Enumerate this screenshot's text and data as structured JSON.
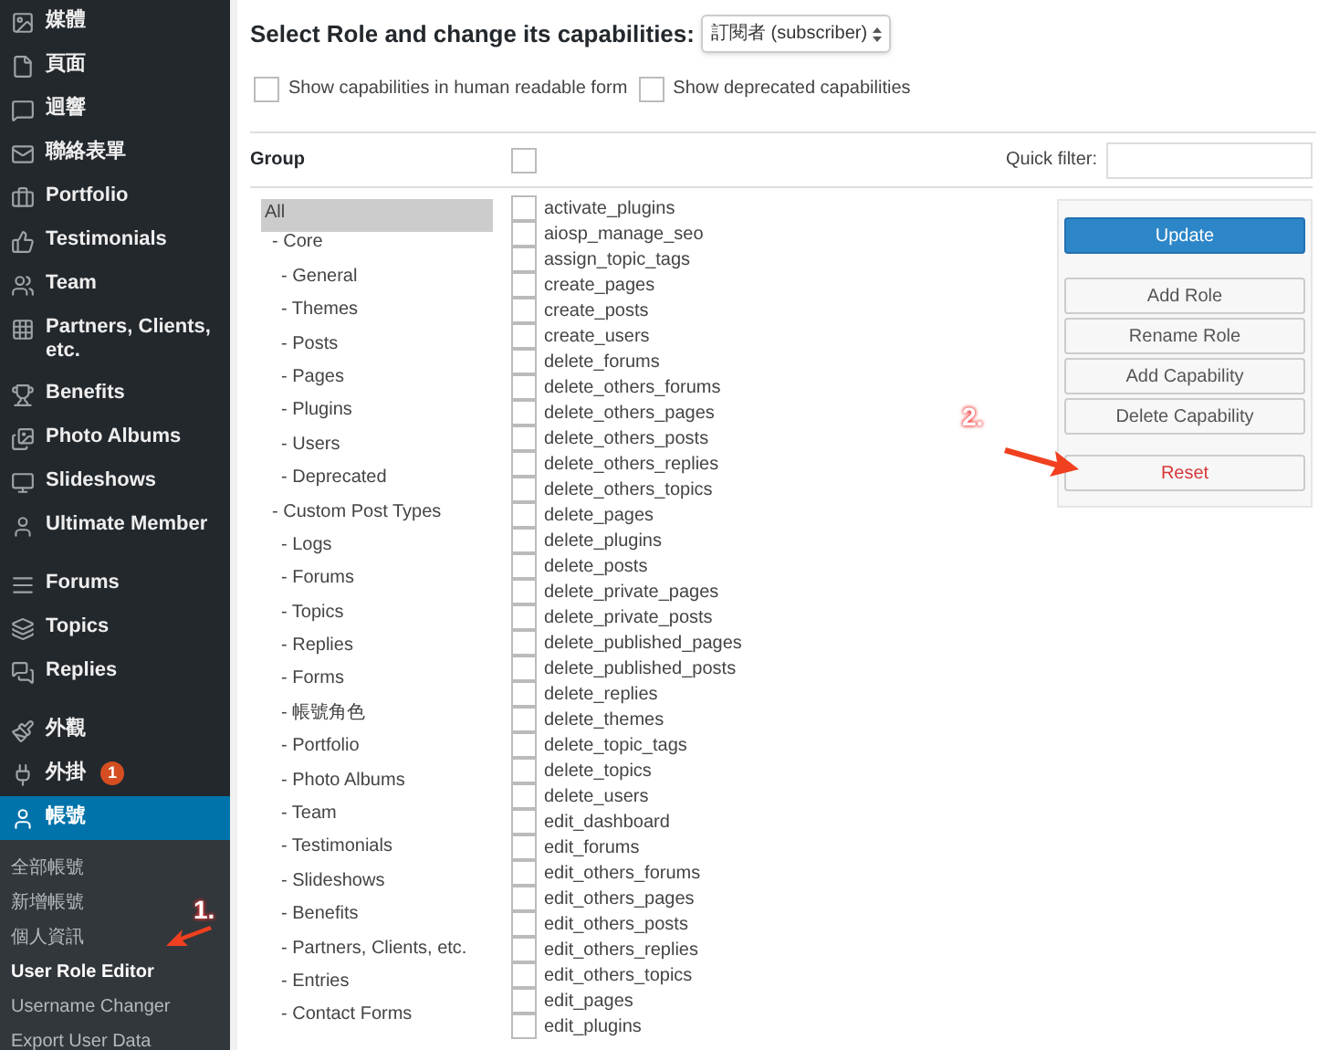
{
  "sidebar": {
    "menu_groups": [
      [
        {
          "label": "媒體",
          "selected": false
        },
        {
          "label": "頁面",
          "selected": false
        },
        {
          "label": "迴響",
          "selected": false
        },
        {
          "label": "聯絡表單",
          "selected": false
        },
        {
          "label": "Portfolio",
          "selected": false
        },
        {
          "label": "Testimonials",
          "selected": false
        },
        {
          "label": "Team",
          "selected": false
        },
        {
          "label": "Partners, Clients, etc.",
          "selected": false
        },
        {
          "label": "Benefits",
          "selected": false
        },
        {
          "label": "Photo Albums",
          "selected": false
        },
        {
          "label": "Slideshows",
          "selected": false
        },
        {
          "label": "Ultimate Member",
          "selected": false
        }
      ],
      [
        {
          "label": "Forums",
          "selected": false
        },
        {
          "label": "Topics",
          "selected": false
        },
        {
          "label": "Replies",
          "selected": false
        }
      ],
      [
        {
          "label": "外觀",
          "selected": false
        },
        {
          "label": "外掛",
          "selected": false,
          "badge": "1"
        },
        {
          "label": "帳號",
          "selected": true
        }
      ]
    ],
    "submenu": [
      {
        "label": "全部帳號",
        "selected": false
      },
      {
        "label": "新增帳號",
        "selected": false
      },
      {
        "label": "個人資訊",
        "selected": false
      },
      {
        "label": "User Role Editor",
        "selected": true
      },
      {
        "label": "Username Changer",
        "selected": false
      },
      {
        "label": "Export User Data",
        "selected": false
      }
    ]
  },
  "heading": "Select Role and change its capabilities:",
  "role_select": {
    "value": "訂閱者 (subscriber)"
  },
  "options": [
    {
      "label": "Show capabilities in human readable form",
      "checked": false
    },
    {
      "label": "Show deprecated capabilities",
      "checked": false
    }
  ],
  "group_header": "Group",
  "select_all": {
    "checked": false
  },
  "quick_filter": {
    "label": "Quick filter:"
  },
  "groups": [
    {
      "label": "All",
      "selected": true,
      "children": [
        {
          "label": "- Core",
          "selected": false,
          "children": [
            {
              "label": "- General",
              "selected": false
            },
            {
              "label": "- Themes",
              "selected": false
            },
            {
              "label": "- Posts",
              "selected": false
            },
            {
              "label": "- Pages",
              "selected": false
            },
            {
              "label": "- Plugins",
              "selected": false
            },
            {
              "label": "- Users",
              "selected": false
            },
            {
              "label": "- Deprecated",
              "selected": false
            }
          ]
        },
        {
          "label": "- Custom Post Types",
          "selected": false,
          "children": [
            {
              "label": "- Logs",
              "selected": false
            },
            {
              "label": "- Forums",
              "selected": false
            },
            {
              "label": "- Topics",
              "selected": false
            },
            {
              "label": "- Replies",
              "selected": false
            },
            {
              "label": "- Forms",
              "selected": false
            },
            {
              "label": "- 帳號角色",
              "selected": false
            },
            {
              "label": "- Portfolio",
              "selected": false
            },
            {
              "label": "- Photo Albums",
              "selected": false
            },
            {
              "label": "- Team",
              "selected": false
            },
            {
              "label": "- Testimonials",
              "selected": false
            },
            {
              "label": "- Slideshows",
              "selected": false
            },
            {
              "label": "- Benefits",
              "selected": false
            },
            {
              "label": "- Partners, Clients, etc.",
              "selected": false
            },
            {
              "label": "- Entries",
              "selected": false
            },
            {
              "label": "- Contact Forms",
              "selected": false
            }
          ]
        }
      ]
    }
  ],
  "capabilities": [
    {
      "name": "activate_plugins",
      "checked": false
    },
    {
      "name": "aiosp_manage_seo",
      "checked": false
    },
    {
      "name": "assign_topic_tags",
      "checked": false
    },
    {
      "name": "create_pages",
      "checked": false
    },
    {
      "name": "create_posts",
      "checked": false
    },
    {
      "name": "create_users",
      "checked": false
    },
    {
      "name": "delete_forums",
      "checked": false
    },
    {
      "name": "delete_others_forums",
      "checked": false
    },
    {
      "name": "delete_others_pages",
      "checked": false
    },
    {
      "name": "delete_others_posts",
      "checked": false
    },
    {
      "name": "delete_others_replies",
      "checked": false
    },
    {
      "name": "delete_others_topics",
      "checked": false
    },
    {
      "name": "delete_pages",
      "checked": false
    },
    {
      "name": "delete_plugins",
      "checked": false
    },
    {
      "name": "delete_posts",
      "checked": false
    },
    {
      "name": "delete_private_pages",
      "checked": false
    },
    {
      "name": "delete_private_posts",
      "checked": false
    },
    {
      "name": "delete_published_pages",
      "checked": false
    },
    {
      "name": "delete_published_posts",
      "checked": false
    },
    {
      "name": "delete_replies",
      "checked": false
    },
    {
      "name": "delete_themes",
      "checked": false
    },
    {
      "name": "delete_topic_tags",
      "checked": false
    },
    {
      "name": "delete_topics",
      "checked": false
    },
    {
      "name": "delete_users",
      "checked": false
    },
    {
      "name": "edit_dashboard",
      "checked": false
    },
    {
      "name": "edit_forums",
      "checked": false
    },
    {
      "name": "edit_others_forums",
      "checked": false
    },
    {
      "name": "edit_others_pages",
      "checked": false
    },
    {
      "name": "edit_others_posts",
      "checked": false
    },
    {
      "name": "edit_others_replies",
      "checked": false
    },
    {
      "name": "edit_others_topics",
      "checked": false
    },
    {
      "name": "edit_pages",
      "checked": false
    },
    {
      "name": "edit_plugins",
      "checked": false
    }
  ],
  "actions": [
    {
      "label": "Update",
      "kind": "primary"
    },
    {
      "label": "Add Role",
      "kind": "default"
    },
    {
      "label": "Rename Role",
      "kind": "default"
    },
    {
      "label": "Add Capability",
      "kind": "default"
    },
    {
      "label": "Delete Capability",
      "kind": "default"
    },
    {
      "label": "Reset",
      "kind": "danger"
    }
  ],
  "annotations": [
    "1.",
    "2."
  ]
}
